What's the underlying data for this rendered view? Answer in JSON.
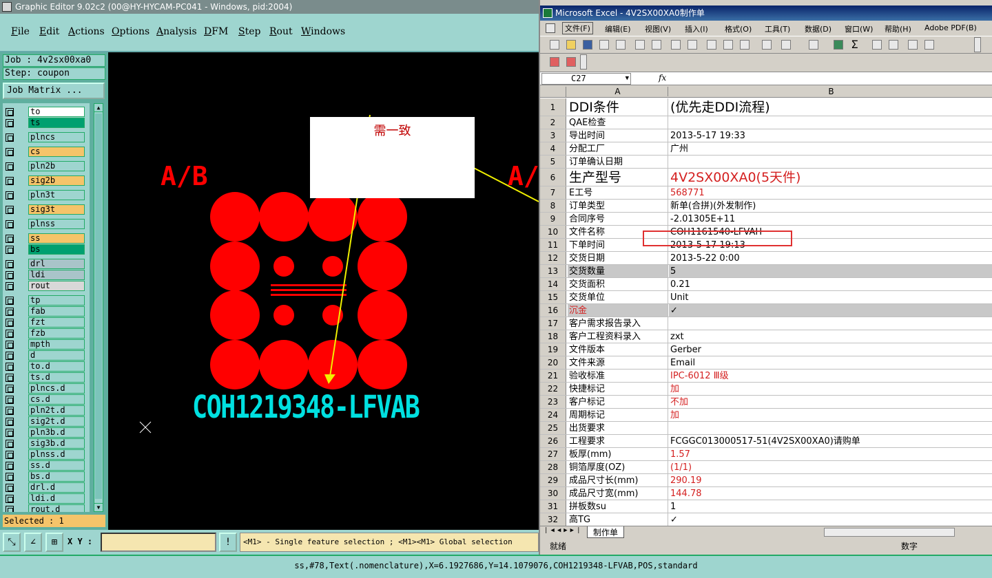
{
  "ge": {
    "title": "Graphic Editor 9.02c2 (00@HY-HYCAM-PC041 - Windows, pid:2004)",
    "menu": [
      "File",
      "Edit",
      "Actions",
      "Options",
      "Analysis",
      "DFM",
      "Step",
      "Rout",
      "Windows"
    ],
    "job": "Job : 4v2sx00xa0",
    "step": "Step: coupon",
    "job_matrix": "Job Matrix ...",
    "layers": [
      {
        "name": "to",
        "color": "#ffffff"
      },
      {
        "name": "ts",
        "color": "#00a070"
      },
      {
        "name": "plncs",
        "color": "#9ed5cf"
      },
      {
        "name": "cs",
        "color": "#f5c46a"
      },
      {
        "name": "pln2b",
        "color": "#9ed5cf"
      },
      {
        "name": "sig2b",
        "color": "#f5c46a"
      },
      {
        "name": "pln3t",
        "color": "#9ed5cf"
      },
      {
        "name": "sig3t",
        "color": "#f5c46a"
      },
      {
        "name": "plnss",
        "color": "#9ed5cf"
      },
      {
        "name": "ss",
        "color": "#f5c46a"
      },
      {
        "name": "bs",
        "color": "#00a070"
      },
      {
        "name": "drl",
        "color": "#a9c4c9"
      },
      {
        "name": "ldi",
        "color": "#a9c4c9"
      },
      {
        "name": "rout",
        "color": "#d8d8d8"
      },
      {
        "name": "tp",
        "color": "#9ed5cf"
      },
      {
        "name": "fab",
        "color": "#9ed5cf"
      },
      {
        "name": "fzt",
        "color": "#9ed5cf"
      },
      {
        "name": "fzb",
        "color": "#9ed5cf"
      },
      {
        "name": "mpth",
        "color": "#9ed5cf"
      },
      {
        "name": "d",
        "color": "#9ed5cf"
      },
      {
        "name": "to.d",
        "color": "#9ed5cf"
      },
      {
        "name": "ts.d",
        "color": "#9ed5cf"
      },
      {
        "name": "plncs.d",
        "color": "#9ed5cf"
      },
      {
        "name": "cs.d",
        "color": "#9ed5cf"
      },
      {
        "name": "pln2t.d",
        "color": "#9ed5cf"
      },
      {
        "name": "sig2t.d",
        "color": "#9ed5cf"
      },
      {
        "name": "pln3b.d",
        "color": "#9ed5cf"
      },
      {
        "name": "sig3b.d",
        "color": "#9ed5cf"
      },
      {
        "name": "plnss.d",
        "color": "#9ed5cf"
      },
      {
        "name": "ss.d",
        "color": "#9ed5cf"
      },
      {
        "name": "bs.d",
        "color": "#9ed5cf"
      },
      {
        "name": "drl.d",
        "color": "#9ed5cf"
      },
      {
        "name": "ldi.d",
        "color": "#9ed5cf"
      },
      {
        "name": "rout.d",
        "color": "#9ed5cf"
      }
    ],
    "selected": "Selected : 1",
    "canvas": {
      "ab_left": "A/B",
      "ab_right": "A/",
      "note": "需一致",
      "feature_text": "COH1219348-LFVAB"
    },
    "xy_label": "X Y :",
    "hint": "<M1> - Single feature selection ; <M1><M1> Global selection",
    "status": "ss,#78,Text(.nomenclature),X=6.1927686,Y=14.1079076,COH1219348-LFVAB,POS,standard",
    "colors": {
      "panel": "#9ed5cf",
      "canvas": "#000000",
      "pad": "#ff0000",
      "text": "#00e0e0"
    }
  },
  "xl": {
    "title": "Microsoft Excel - 4V2SX00XA0制作单",
    "menu": [
      "文件(F)",
      "编辑(E)",
      "视图(V)",
      "插入(I)",
      "格式(O)",
      "工具(T)",
      "数据(D)",
      "窗口(W)",
      "帮助(H)",
      "Adobe PDF(B)"
    ],
    "namebox": "C27",
    "fx": "fx",
    "col_a": "A",
    "col_b": "B",
    "rows": [
      {
        "n": "1",
        "a": "DDI条件",
        "b": "(优先走DDI流程)",
        "big": true
      },
      {
        "n": "2",
        "a": "QAE检查",
        "b": ""
      },
      {
        "n": "3",
        "a": "导出时间",
        "b": "2013-5-17 19:33"
      },
      {
        "n": "4",
        "a": "分配工厂",
        "b": "广州"
      },
      {
        "n": "5",
        "a": "订单确认日期",
        "b": ""
      },
      {
        "n": "6",
        "a": "生产型号",
        "b": "4V2SX00XA0(5天件)",
        "big": true,
        "bred": true
      },
      {
        "n": "7",
        "a": "E工号",
        "b": "568771",
        "bred": true
      },
      {
        "n": "8",
        "a": "订单类型",
        "b": "新单(合拼)(外发制作)"
      },
      {
        "n": "9",
        "a": "合同序号",
        "b": "-2.01305E+11"
      },
      {
        "n": "10",
        "a": "文件名称",
        "b": "COH1161540-LFVAH"
      },
      {
        "n": "11",
        "a": "下单时间",
        "b": "2013-5-17 19:13"
      },
      {
        "n": "12",
        "a": "交货日期",
        "b": "2013-5-22 0:00"
      },
      {
        "n": "13",
        "a": "交货数量",
        "b": "5",
        "grey": true
      },
      {
        "n": "14",
        "a": "交货面积",
        "b": "0.21"
      },
      {
        "n": "15",
        "a": "交货单位",
        "b": "Unit"
      },
      {
        "n": "16",
        "a": "沉金",
        "b": "✓",
        "ared": true,
        "grey": true
      },
      {
        "n": "17",
        "a": "客户需求报告录入",
        "b": ""
      },
      {
        "n": "18",
        "a": "客户工程资料录入",
        "b": "zxt"
      },
      {
        "n": "19",
        "a": "文件版本",
        "b": "Gerber"
      },
      {
        "n": "20",
        "a": "文件来源",
        "b": "Email"
      },
      {
        "n": "21",
        "a": "验收标准",
        "b": "IPC-6012 Ⅲ级",
        "bred": true
      },
      {
        "n": "22",
        "a": "快捷标记",
        "b": "加",
        "bred": true
      },
      {
        "n": "23",
        "a": "客户标记",
        "b": "不加",
        "bred": true
      },
      {
        "n": "24",
        "a": "周期标记",
        "b": "加",
        "bred": true
      },
      {
        "n": "25",
        "a": "出货要求",
        "b": ""
      },
      {
        "n": "26",
        "a": "工程要求",
        "b": "FCGGC013000517-51(4V2SX00XA0)请购单"
      },
      {
        "n": "27",
        "a": "板厚(mm)",
        "b": "1.57",
        "bred": true
      },
      {
        "n": "28",
        "a": "铜箔厚度(OZ)",
        "b": "(1/1)",
        "bred": true
      },
      {
        "n": "29",
        "a": "成品尺寸长(mm)",
        "b": "290.19",
        "bred": true
      },
      {
        "n": "30",
        "a": "成品尺寸宽(mm)",
        "b": "144.78",
        "bred": true
      },
      {
        "n": "31",
        "a": "拼板数su",
        "b": "1"
      },
      {
        "n": "32",
        "a": "高TG",
        "b": "✓"
      }
    ],
    "sheet_tab": "制作单",
    "status_left": "就绪",
    "status_right": "数字"
  }
}
